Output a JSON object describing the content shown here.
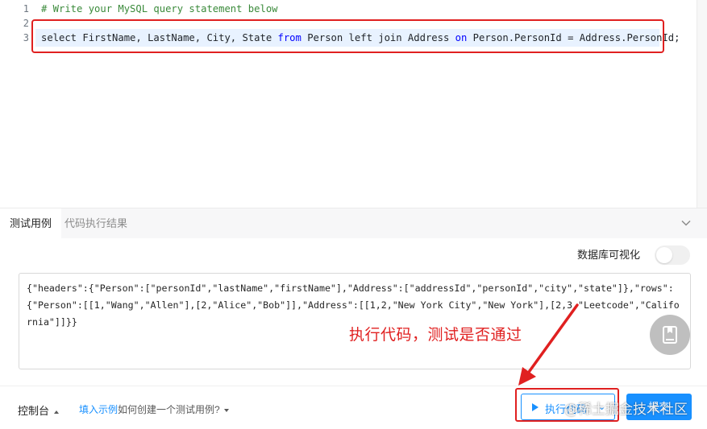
{
  "editor": {
    "line_numbers": [
      "1",
      "2",
      "3"
    ],
    "line1_comment": "# Write your MySQL query statement below",
    "line3": {
      "t1": "select FirstName, LastName, City, State ",
      "kw1": "from",
      "t2": " Person left join Address ",
      "kw2": "on",
      "t3": " Person.PersonId = Address.PersonId;"
    }
  },
  "tabs": {
    "testcase": "测试用例",
    "result": "代码执行结果"
  },
  "panel": {
    "db_visualize_label": "数据库可视化",
    "db_visualize_on": false,
    "testcase_text": "{\"headers\":{\"Person\":[\"personId\",\"lastName\",\"firstName\"],\"Address\":[\"addressId\",\"personId\",\"city\",\"state\"]},\"rows\":{\"Person\":[[1,\"Wang\",\"Allen\"],[2,\"Alice\",\"Bob\"]],\"Address\":[[1,2,\"New York City\",\"New York\"],[2,3,\"Leetcode\",\"California\"]]}}"
  },
  "annotation": {
    "text": "执行代码，测试是否通过",
    "color": "#e02020"
  },
  "footer": {
    "console": "控制台",
    "fill_example": "填入示例",
    "how_to": "如何创建一个测试用例?",
    "run": "执行代码",
    "run_caret": "⌄",
    "submit": "提交",
    "watermark": "@稀土掘金技术社区"
  },
  "colors": {
    "accent": "#1890ff",
    "annotation_red": "#e02020",
    "keyword_blue": "#0000ff",
    "comment_green": "#3a8a3a"
  }
}
